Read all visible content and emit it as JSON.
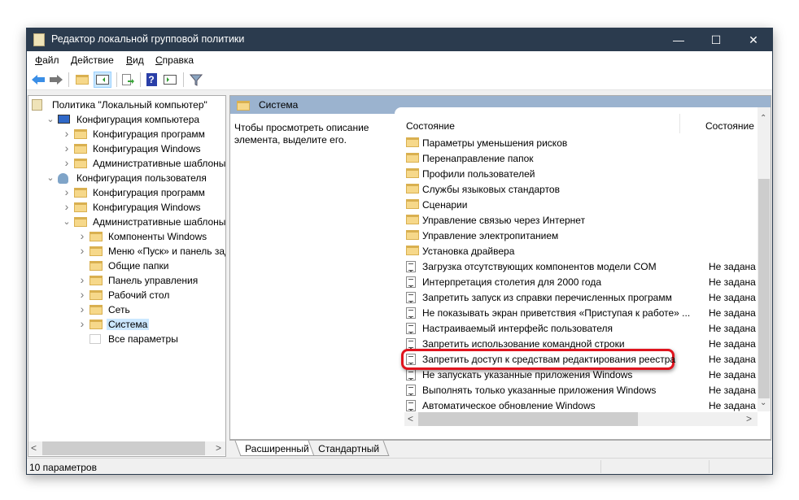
{
  "window": {
    "title": "Редактор локальной групповой политики",
    "minimize": "—",
    "maximize": "☐",
    "close": "✕"
  },
  "menu": [
    {
      "u": "Ф",
      "rest": "айл"
    },
    {
      "u": "Д",
      "rest": "ействие"
    },
    {
      "u": "В",
      "rest": "ид"
    },
    {
      "u": "С",
      "rest": "правка"
    }
  ],
  "toolbar": [
    "back",
    "forward",
    "up",
    "show-hide-tree",
    "export-list",
    "help",
    "show-hide-action-pane",
    "filter"
  ],
  "tree": [
    {
      "label": "Политика \"Локальный компьютер\"",
      "level": 0,
      "icon": "policy",
      "arrow": ""
    },
    {
      "label": "Конфигурация компьютера",
      "level": 1,
      "icon": "computer",
      "arrow": "open"
    },
    {
      "label": "Конфигурация программ",
      "level": 2,
      "icon": "folder",
      "arrow": "closed"
    },
    {
      "label": "Конфигурация Windows",
      "level": 2,
      "icon": "folder",
      "arrow": "closed"
    },
    {
      "label": "Административные шаблоны",
      "level": 2,
      "icon": "folder",
      "arrow": "closed"
    },
    {
      "label": "Конфигурация пользователя",
      "level": 1,
      "icon": "user",
      "arrow": "open"
    },
    {
      "label": "Конфигурация программ",
      "level": 2,
      "icon": "folder",
      "arrow": "closed"
    },
    {
      "label": "Конфигурация Windows",
      "level": 2,
      "icon": "folder",
      "arrow": "closed"
    },
    {
      "label": "Административные шаблоны",
      "level": 2,
      "icon": "folder",
      "arrow": "open"
    },
    {
      "label": "Компоненты Windows",
      "level": 3,
      "icon": "folder",
      "arrow": "closed"
    },
    {
      "label": "Меню «Пуск» и панель задач",
      "level": 3,
      "icon": "folder",
      "arrow": "closed"
    },
    {
      "label": "Общие папки",
      "level": 3,
      "icon": "folder",
      "arrow": ""
    },
    {
      "label": "Панель управления",
      "level": 3,
      "icon": "folder",
      "arrow": "closed"
    },
    {
      "label": "Рабочий стол",
      "level": 3,
      "icon": "folder",
      "arrow": "closed"
    },
    {
      "label": "Сеть",
      "level": 3,
      "icon": "folder",
      "arrow": "closed"
    },
    {
      "label": "Система",
      "level": 3,
      "icon": "folder",
      "arrow": "closed",
      "selected": true
    },
    {
      "label": "Все параметры",
      "level": 3,
      "icon": "settings",
      "arrow": ""
    }
  ],
  "right": {
    "header": "Система",
    "description": "Чтобы просмотреть описание элемента, выделите его.",
    "col1": "Состояние",
    "col2": "Состояние",
    "rows": [
      {
        "name": "Параметры уменьшения рисков",
        "type": "folder",
        "state": ""
      },
      {
        "name": "Перенаправление папок",
        "type": "folder",
        "state": ""
      },
      {
        "name": "Профили пользователей",
        "type": "folder",
        "state": ""
      },
      {
        "name": "Службы языковых стандартов",
        "type": "folder",
        "state": ""
      },
      {
        "name": "Сценарии",
        "type": "folder",
        "state": ""
      },
      {
        "name": "Управление связью через Интернет",
        "type": "folder",
        "state": ""
      },
      {
        "name": "Управление электропитанием",
        "type": "folder",
        "state": ""
      },
      {
        "name": "Установка драйвера",
        "type": "folder",
        "state": ""
      },
      {
        "name": "Загрузка отсутствующих компонентов модели COM",
        "type": "policy",
        "state": "Не задана"
      },
      {
        "name": "Интерпретация столетия для 2000 года",
        "type": "policy",
        "state": "Не задана"
      },
      {
        "name": "Запретить запуск из справки перечисленных программ",
        "type": "policy",
        "state": "Не задана"
      },
      {
        "name": "Не показывать экран приветствия «Приступая к работе» ...",
        "type": "policy",
        "state": "Не задана"
      },
      {
        "name": "Настраиваемый интерфейс пользователя",
        "type": "policy",
        "state": "Не задана"
      },
      {
        "name": "Запретить использование командной строки",
        "type": "policy",
        "state": "Не задана"
      },
      {
        "name": "Запретить доступ к средствам редактирования реестра",
        "type": "policy",
        "state": "Не задана",
        "highlighted": true
      },
      {
        "name": "Не запускать указанные приложения Windows",
        "type": "policy",
        "state": "Не задана"
      },
      {
        "name": "Выполнять только указанные приложения Windows",
        "type": "policy",
        "state": "Не задана"
      },
      {
        "name": "Автоматическое обновление Windows",
        "type": "policy",
        "state": "Не задана"
      }
    ]
  },
  "tabs": [
    "Расширенный",
    "Стандартный"
  ],
  "status": "10 параметров",
  "colors": {
    "titlebar": "#2b3b4e",
    "header": "#9bb3cf",
    "highlight": "#e0141e"
  }
}
